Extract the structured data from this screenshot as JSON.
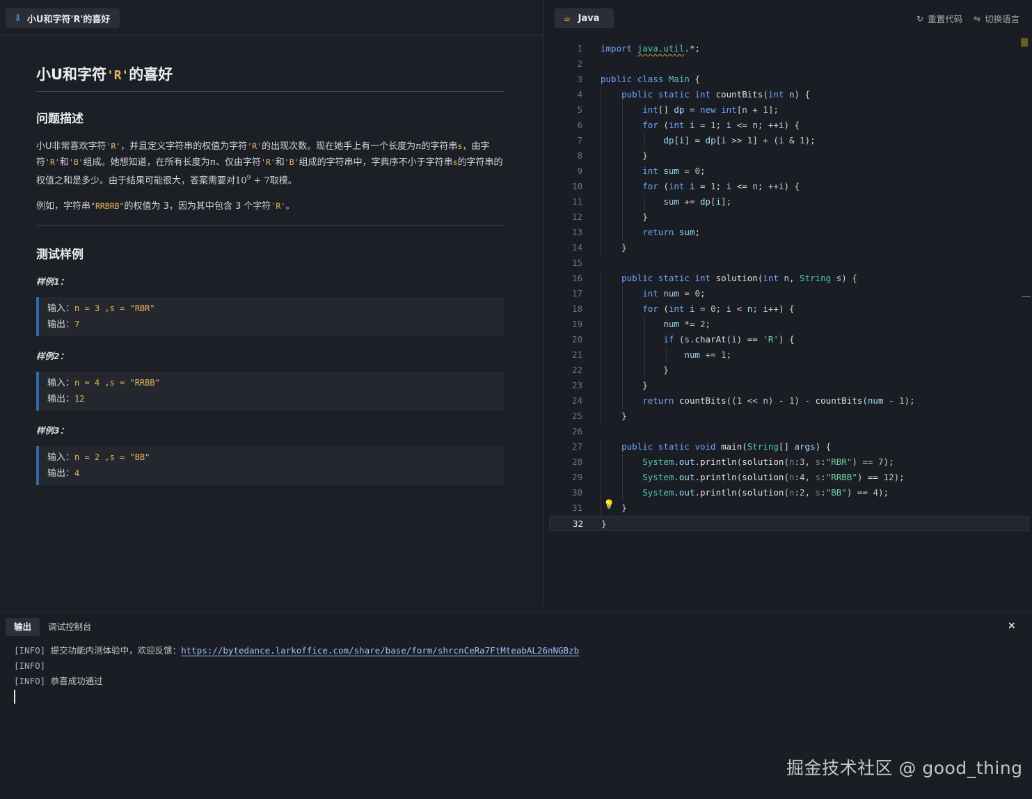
{
  "left_tab": {
    "icon": "download-arrow-icon",
    "title": "小U和字符'R'的喜好"
  },
  "problem": {
    "title_prefix": "小U和字符",
    "title_code": "'R'",
    "title_suffix": "的喜好",
    "desc_heading": "问题描述",
    "desc": {
      "s1": "小U非常喜欢字符",
      "c1": "'R'",
      "s2": "，并且定义字符串的权值为字符",
      "c2": "'R'",
      "s3": "的出现次数。现在她手上有一个长度为",
      "m1": "n",
      "s4": "的字符串",
      "c3": "s",
      "s5": "，由字符",
      "c4": "'R'",
      "s6": "和",
      "c5": "'B'",
      "s7": "组成。她想知道，在所有长度为",
      "m2": "n",
      "s8": "、仅由字符",
      "c6": "'R'",
      "s9": "和",
      "c7": "'B'",
      "s10": "组成的字符串中，字典序不小于字符串",
      "c8": "s",
      "s11": "的字符串的权值之和是多少。由于结果可能很大，答案需要对",
      "m3": "10",
      "m3sup": "9",
      "m3b": " + 7",
      "s12": "取模。"
    },
    "example": {
      "s1": "例如，字符串",
      "c1": "\"RRBRB\"",
      "s2": "的权值为 3，因为其中包含 3 个字符",
      "c2": "'R'",
      "s3": "。"
    },
    "tests_heading": "测试样例",
    "samples": [
      {
        "heading": "样例1：",
        "in_label": "输入：",
        "in_value": "n = 3 ,s = \"RBR\"",
        "out_label": "输出：",
        "out_value": "7"
      },
      {
        "heading": "样例2：",
        "in_label": "输入：",
        "in_value": "n = 4 ,s = \"RRBB\"",
        "out_label": "输出：",
        "out_value": "12"
      },
      {
        "heading": "样例3：",
        "in_label": "输入：",
        "in_value": "n = 2 ,s = \"BB\"",
        "out_label": "输出：",
        "out_value": "4"
      }
    ]
  },
  "editor_toolbar": {
    "lang_icon": "cup-icon",
    "language": "Java",
    "reset_icon": "reset-icon",
    "reset_label": "重置代码",
    "switch_icon": "switch-icon",
    "switch_label": "切换语言"
  },
  "code_lines": [
    "import java.util.*;",
    "",
    "public class Main {",
    "    public static int countBits(int n) {",
    "        int[] dp = new int[n + 1];",
    "        for (int i = 1; i <= n; ++i) {",
    "            dp[i] = dp[i >> 1] + (i & 1);",
    "        }",
    "        int sum = 0;",
    "        for (int i = 1; i <= n; ++i) {",
    "            sum += dp[i];",
    "        }",
    "        return sum;",
    "    }",
    "",
    "    public static int solution(int n, String s) {",
    "        int num = 0;",
    "        for (int i = 0; i < n; i++) {",
    "            num *= 2;",
    "            if (s.charAt(i) == 'R') {",
    "                num += 1;",
    "            }",
    "        }",
    "        return countBits((1 << n) - 1) - countBits(num - 1);",
    "    }",
    "",
    "    public static void main(String[] args) {",
    "        System.out.println(solution(n:3, s:\"RBR\") == 7);",
    "        System.out.println(solution(n:4, s:\"RRBB\") == 12);",
    "        System.out.println(solution(n:2, s:\"BB\") == 4);",
    "    }",
    "}"
  ],
  "active_line": 32,
  "output": {
    "tabs": [
      "输出",
      "调试控制台"
    ],
    "active_tab": "输出",
    "close_icon": "close-icon",
    "close_glyph": "×",
    "lines": [
      {
        "tag": "[INFO]",
        "text": " 提交功能内测体验中，欢迎反馈：",
        "link": "https://bytedance.larkoffice.com/share/base/form/shrcnCeRa7FtMteabAL26nNGBzb"
      },
      {
        "tag": "[INFO]",
        "text": "",
        "link": ""
      },
      {
        "tag": "[INFO]",
        "text": " 恭喜成功通过",
        "link": ""
      }
    ]
  },
  "watermark": "掘金技术社区 @ good_thing"
}
